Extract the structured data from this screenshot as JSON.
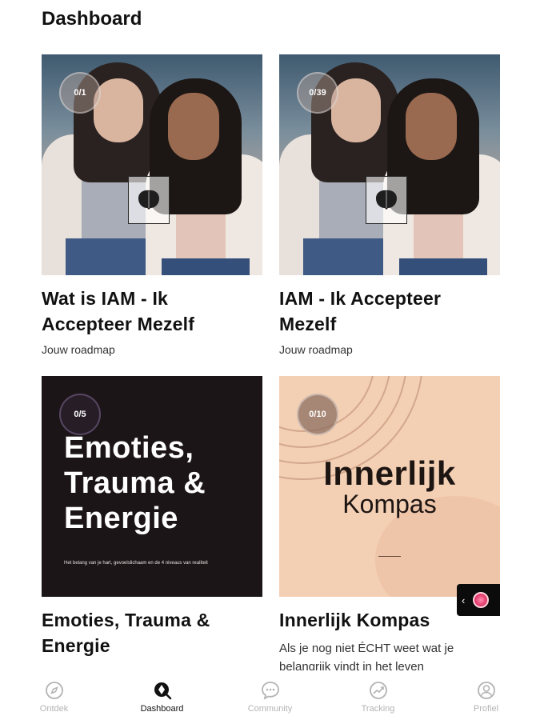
{
  "page": {
    "title": "Dashboard"
  },
  "cards": [
    {
      "progress": "0/1",
      "title": "Wat is IAM - Ik Accepteer Mezelf",
      "subtitle": "Jouw roadmap"
    },
    {
      "progress": "0/39",
      "title": "IAM - Ik Accepteer Mezelf",
      "subtitle": "Jouw roadmap"
    },
    {
      "progress": "0/5",
      "title": "Emoties, Trauma & Energie",
      "subtitle": "",
      "art": {
        "headline_1": "Emoties,",
        "headline_2": "Trauma &",
        "headline_3": "Energie",
        "caption": "Het belang van je hart, gevoelslichaam en de 4 niveaus van realiteit"
      }
    },
    {
      "progress": "0/10",
      "title": "Innerlijk Kompas",
      "description": "Als je nog niet ÉCHT weet wat je belangrijk vindt in het leven",
      "art": {
        "headline_1": "Innerlijk",
        "headline_2": "Kompas"
      }
    }
  ],
  "scroll_tab": {
    "chevron": "‹"
  },
  "nav": [
    {
      "label": "Ontdek",
      "icon": "compass-icon",
      "active": false
    },
    {
      "label": "Dashboard",
      "icon": "dashboard-search-icon",
      "active": true
    },
    {
      "label": "Community",
      "icon": "chat-bubble-icon",
      "active": false
    },
    {
      "label": "Tracking",
      "icon": "chart-trend-icon",
      "active": false
    },
    {
      "label": "Profiel",
      "icon": "user-icon",
      "active": false
    }
  ],
  "colors": {
    "emoties_bg": "#1c1517",
    "kompas_bg": "#f3cfb4",
    "nav_active": "#111111",
    "nav_inactive": "#b3b3b3"
  }
}
